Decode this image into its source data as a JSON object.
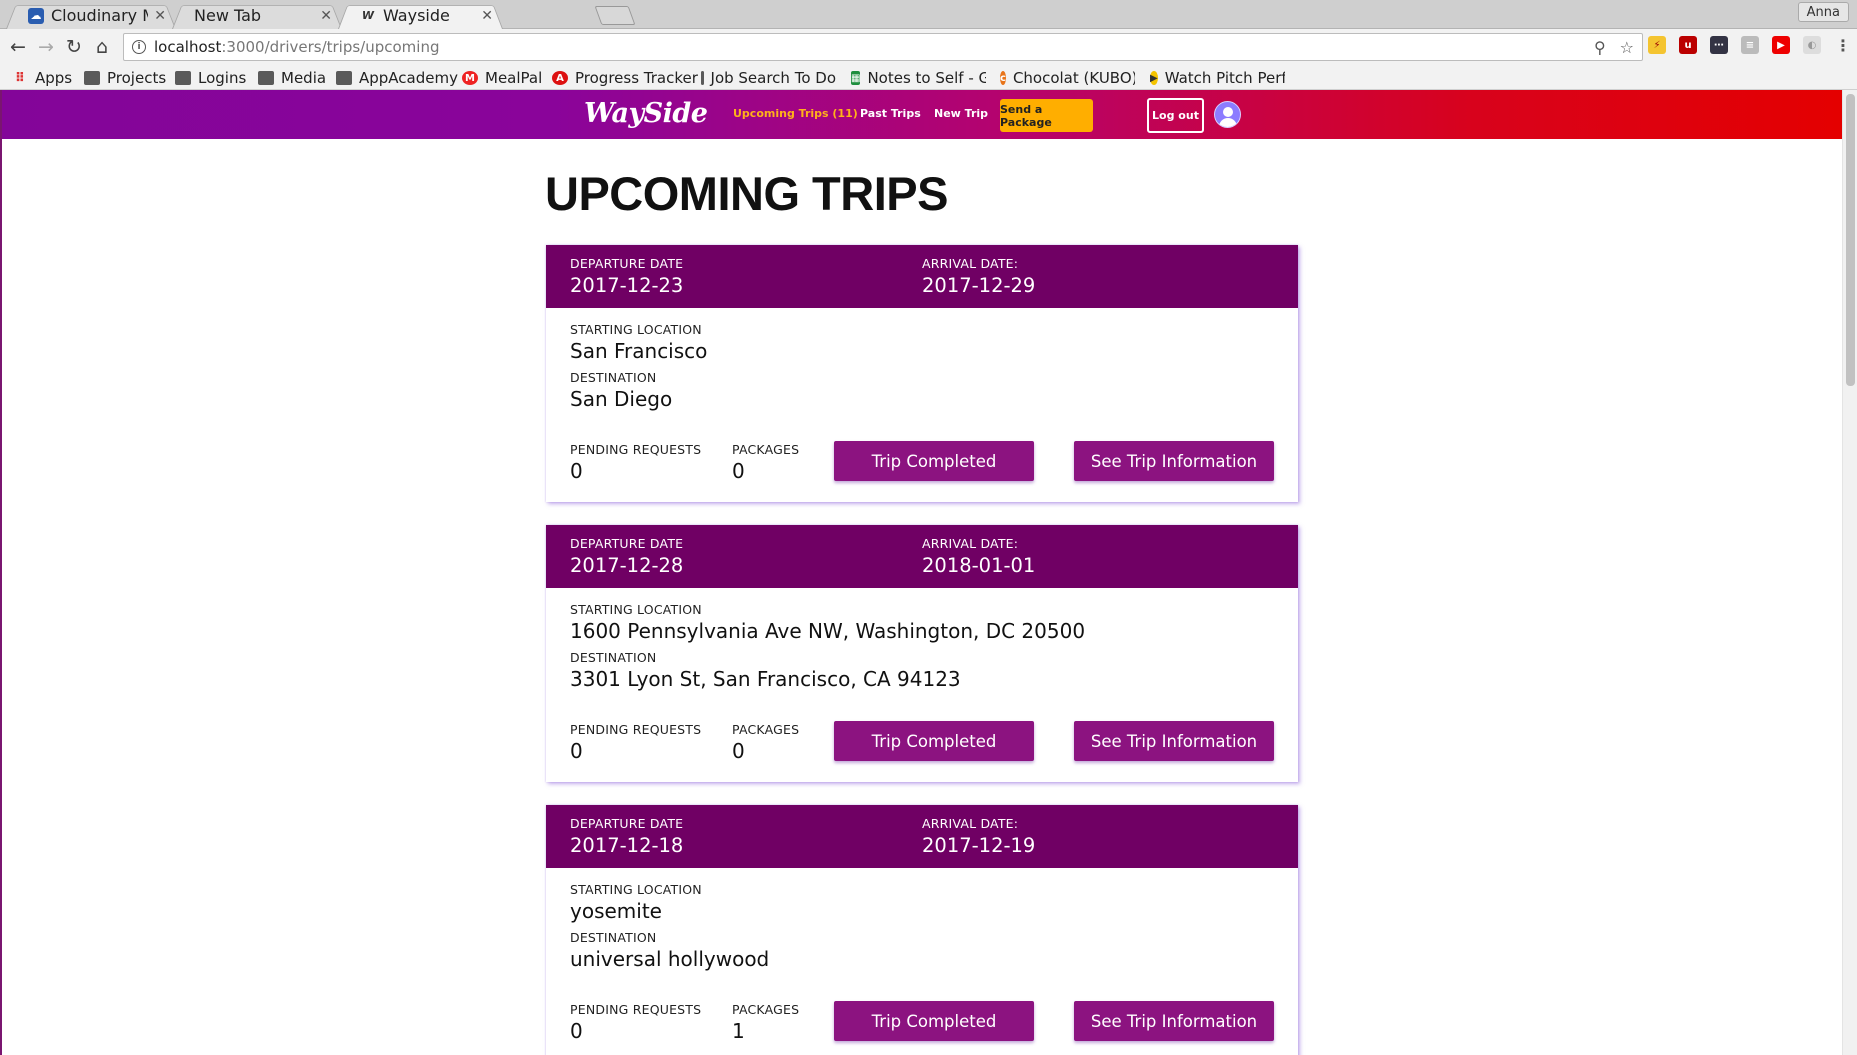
{
  "browser": {
    "tabs": [
      {
        "title": "Cloudinary Manage",
        "favicon": "cloudinary-icon",
        "active": false
      },
      {
        "title": "New Tab",
        "favicon": "",
        "active": false
      },
      {
        "title": "Wayside",
        "favicon": "wayside-icon",
        "active": true
      }
    ],
    "profile_name": "Anna",
    "url_host": "localhost",
    "url_path": ":3000/drivers/trips/upcoming",
    "bookmarks": [
      {
        "label": "Apps",
        "icon": "apps-grid-icon"
      },
      {
        "label": "Projects",
        "icon": "folder-icon"
      },
      {
        "label": "Logins",
        "icon": "folder-icon"
      },
      {
        "label": "Media",
        "icon": "folder-icon"
      },
      {
        "label": "AppAcademy",
        "icon": "folder-icon"
      },
      {
        "label": "MealPal",
        "icon": "mealpal-icon"
      },
      {
        "label": "Progress Tracker",
        "icon": "progress-tracker-icon"
      },
      {
        "label": "Job Search To Do",
        "icon": "folder-icon"
      },
      {
        "label": "Notes to Self - Go",
        "icon": "sheets-icon"
      },
      {
        "label": "Chocolat (KUBO)",
        "icon": "chocolat-icon"
      },
      {
        "label": "Watch Pitch Perf",
        "icon": "play-icon"
      }
    ]
  },
  "nav": {
    "logo": "WaySide",
    "upcoming_label": "Upcoming Trips (11)",
    "past_label": "Past Trips",
    "new_label": "New Trip",
    "send_label": "Send a Package",
    "logout_label": "Log out",
    "colors": {
      "gradient_start": "#830599",
      "gradient_end": "#e40000",
      "active_link": "#ffb21a",
      "send_button": "#ffae00"
    }
  },
  "page": {
    "title": "UPCOMING TRIPS"
  },
  "labels": {
    "departure": "DEPARTURE DATE",
    "arrival": "ARRIVAL DATE:",
    "starting": "STARTING LOCATION",
    "destination": "DESTINATION",
    "pending": "PENDING REQUESTS",
    "packages": "PACKAGES",
    "trip_completed": "Trip Completed",
    "see_info": "See Trip Information"
  },
  "trips": [
    {
      "departure": "2017-12-23",
      "arrival": "2017-12-29",
      "start": "San Francisco",
      "destination": "San Diego",
      "pending": "0",
      "packages": "0"
    },
    {
      "departure": "2017-12-28",
      "arrival": "2018-01-01",
      "start": "1600 Pennsylvania Ave NW, Washington, DC 20500",
      "destination": "3301 Lyon St, San Francisco, CA 94123",
      "pending": "0",
      "packages": "0"
    },
    {
      "departure": "2017-12-18",
      "arrival": "2017-12-19",
      "start": "yosemite",
      "destination": "universal hollywood",
      "pending": "0",
      "packages": "1"
    }
  ],
  "colors": {
    "card_header": "#700064",
    "button": "#8c1380"
  }
}
